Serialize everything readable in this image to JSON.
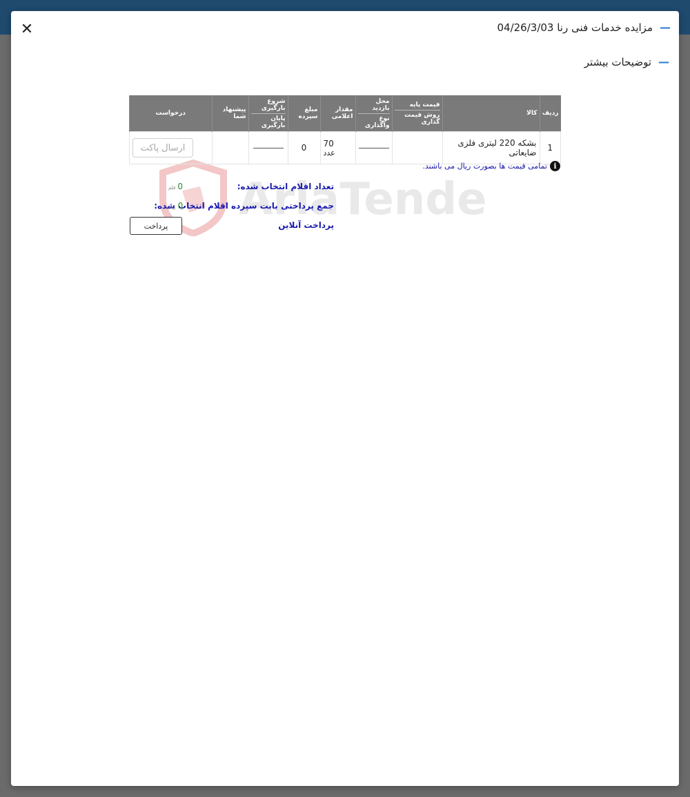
{
  "modal": {
    "close_icon": "close-icon",
    "title": "مزایده خدمات فنی رنا 04/26/3/03",
    "more_details": "توضیحات بیشتر",
    "accent_color": "#2a7ad2"
  },
  "table": {
    "headers": {
      "row": "ردیف",
      "item": "کالا",
      "base_price": "قیمت پایه",
      "pricing_method": "روش قیمت گذاری",
      "visit_location": "محل بازدید",
      "assignment_type": "نوع واگذاری",
      "declared_amount": "مقدار اعلامی",
      "deposit_amount": "مبلغ سپرده",
      "loading_start": "شروع بارگیری",
      "loading_end": "پایان بارگیری",
      "your_offer": "پیشنهاد شما",
      "request": "درخواست"
    },
    "rows": [
      {
        "index": "1",
        "item": "بشکه 220 لیتری فلزی ضایعاتی",
        "quantity": "70",
        "unit": "عدد",
        "deposit": "0",
        "send_button": "ارسال پاکت"
      }
    ]
  },
  "note": "تمامی قیمت ها بصورت ریال می باشند.",
  "summary": {
    "selected_count_label": "تعداد اقلام انتخاب شده:",
    "selected_count_value": "0",
    "selected_count_unit": "قلم",
    "deposit_total_label": "جمع پرداختی بابت سپرده اقلام انتخاب شده:",
    "deposit_total_value": "0",
    "deposit_total_unit": "ریال",
    "online_payment": "پرداخت آنلاین",
    "pay_button": "پرداخت"
  },
  "watermark": "AriaTender.neT"
}
